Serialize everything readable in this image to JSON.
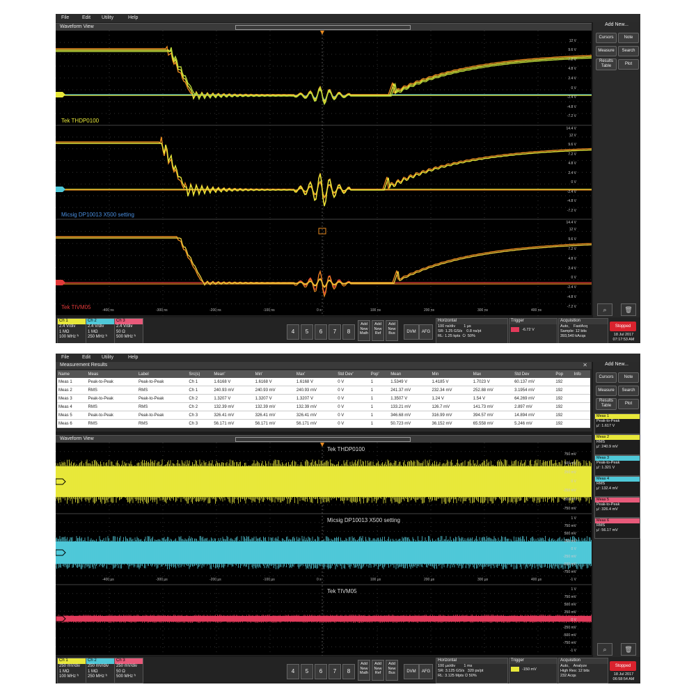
{
  "menu": [
    "File",
    "Edit",
    "Utility",
    "Help"
  ],
  "shot1": {
    "waveform_title": "Waveform View",
    "panel_labels": [
      {
        "text": "Tek THDP0100",
        "color": "#e8e83a"
      },
      {
        "text": "Micsig DP10013 X500 setting",
        "color": "#4a8fe0"
      },
      {
        "text": "Tek TIVM05",
        "color": "#e23a3a"
      }
    ],
    "vticks": [
      "12 V",
      "9.6 V",
      "7.2 V",
      "4.8 V",
      "2.4 V",
      "0 V",
      "-2.4 V",
      "-4.8 V",
      "-7.2 V"
    ],
    "vticks_top": "14.4 V",
    "time_labels": [
      "-400 ns",
      "-300 ns",
      "-200 ns",
      "-100 ns",
      "0 s",
      "100 ns",
      "200 ns",
      "300 ns",
      "400 ns"
    ],
    "channels": [
      {
        "name": "Ch 1",
        "color": "#e8e83a",
        "lines": [
          "2.4 V/div",
          "1 MΩ",
          "100 MHz ʰ"
        ]
      },
      {
        "name": "Ch 2",
        "color": "#4fc8d8",
        "lines": [
          "2.4 V/div",
          "1 MΩ",
          "250 MHz ʰ"
        ]
      },
      {
        "name": "Ch 3",
        "color": "#e85a7a",
        "lines": [
          "2.4 V/div",
          "50 Ω",
          "500 MHz ʰ"
        ]
      }
    ],
    "horizontal": {
      "title": "Horizontal",
      "lines": [
        "100 ns/div        1 µs",
        "SR: 1.25 GS/s    0.8 ns/pt",
        "RL: 1.25 kpts  ⏻  50%"
      ]
    },
    "trigger": {
      "title": "Trigger",
      "value": "-6.72 V"
    },
    "acquisition": {
      "title": "Acquisition",
      "lines": [
        "Auto,    FastAcq",
        "Sample: 12 bits",
        "393,540 kAcqs"
      ]
    },
    "status": "Stopped",
    "date": "18 Jul 2017",
    "time": "07:17:53 AM"
  },
  "shot2": {
    "results_title": "Measurement Results",
    "columns": [
      "Name",
      "Meas",
      "Label",
      "Src(s)",
      "Mean'",
      "Min'",
      "Max'",
      "Std Dev'",
      "Pop'",
      "Mean",
      "Min",
      "Max",
      "Std Dev",
      "Pop",
      "Info"
    ],
    "rows": [
      [
        "Meas 1",
        "Peak-to-Peak",
        "Peak-to-Peak",
        "Ch 1",
        "1.6168 V",
        "1.6168 V",
        "1.6168 V",
        "0 V",
        "1",
        "1.5349 V",
        "1.4185 V",
        "1.7023 V",
        "60.137 mV",
        "192",
        ""
      ],
      [
        "Meas 2",
        "RMS",
        "RMS",
        "Ch 1",
        "240.93 mV",
        "240.93 mV",
        "240.93 mV",
        "0 V",
        "1",
        "241.37 mV",
        "232.34 mV",
        "252.88 mV",
        "3.1954 mV",
        "192",
        ""
      ],
      [
        "Meas 3",
        "Peak-to-Peak",
        "Peak-to-Peak",
        "Ch 2",
        "1.3207 V",
        "1.3207 V",
        "1.3207 V",
        "0 V",
        "1",
        "1.3507 V",
        "1.24 V",
        "1.54 V",
        "64.269 mV",
        "192",
        ""
      ],
      [
        "Meas 4",
        "RMS",
        "RMS",
        "Ch 2",
        "132.39 mV",
        "132.39 mV",
        "132.39 mV",
        "0 V",
        "1",
        "133.21 mV",
        "126.7 mV",
        "141.73 mV",
        "2.897 mV",
        "192",
        ""
      ],
      [
        "Meas 5",
        "Peak-to-Peak",
        "Peak-to-Peak",
        "Ch 3",
        "326.41 mV",
        "326.41 mV",
        "326.41 mV",
        "0 V",
        "1",
        "346.68 mV",
        "316.99 mV",
        "394.57 mV",
        "14.894 mV",
        "192",
        ""
      ],
      [
        "Meas 6",
        "RMS",
        "RMS",
        "Ch 3",
        "56.171 mV",
        "56.171 mV",
        "56.171 mV",
        "0 V",
        "1",
        "50.723 mV",
        "36.152 mV",
        "65.558 mV",
        "5.246 mV",
        "192",
        ""
      ]
    ],
    "waveform_title": "Waveform View",
    "panel_labels": [
      "Tek THDP0100",
      "Micsig DP10013 X500 setting",
      "Tek TIVM05"
    ],
    "vticks_a": [
      "750 mV",
      "500 mV",
      "250 mV",
      "0 V",
      "-250 mV",
      "-500 mV",
      "-750 mV"
    ],
    "vticks_b": [
      "1 V",
      "750 mV",
      "500 mV",
      "250 mV",
      "0 V",
      "-250 mV",
      "-500 mV",
      "-750 mV",
      "-1 V"
    ],
    "vticks_c": [
      "1 V",
      "750 mV",
      "500 mV",
      "250 mV",
      "0 V",
      "-250 mV",
      "-500 mV",
      "-750 mV",
      "-1 V"
    ],
    "time_labels": [
      "-400 µs",
      "-300 µs",
      "-200 µs",
      "-100 µs",
      "0 s",
      "100 µs",
      "200 µs",
      "300 µs",
      "400 µs"
    ],
    "cards": [
      {
        "name": "Meas 1",
        "color": "#e8e83a",
        "type": "Peak-to-Peak",
        "value": "µ': 1.617 V"
      },
      {
        "name": "Meas 2",
        "color": "#e8e83a",
        "type": "RMS",
        "value": "µ': 240.9 mV"
      },
      {
        "name": "Meas 3",
        "color": "#4fc8d8",
        "type": "Peak-to-Peak",
        "value": "µ': 1.321 V"
      },
      {
        "name": "Meas 4",
        "color": "#4fc8d8",
        "type": "RMS",
        "value": "µ': 132.4 mV"
      },
      {
        "name": "Meas 5",
        "color": "#e85a7a",
        "type": "Peak-to-Peak",
        "value": "µ': 326.4 mV"
      },
      {
        "name": "Meas 6",
        "color": "#e85a7a",
        "type": "RMS",
        "value": "µ': 56.17 mV"
      }
    ],
    "channels": [
      {
        "name": "Ch 1",
        "color": "#e8e83a",
        "lines": [
          "250 mV/div",
          "1 MΩ",
          "100 MHz ʰ"
        ]
      },
      {
        "name": "Ch 2",
        "color": "#4fc8d8",
        "lines": [
          "250 mV/div",
          "1 MΩ",
          "250 MHz ʰ"
        ]
      },
      {
        "name": "Ch 3",
        "color": "#e85a7a",
        "lines": [
          "250 mV/div",
          "50 Ω",
          "500 MHz ʰ"
        ]
      }
    ],
    "horizontal": {
      "title": "Horizontal",
      "lines": [
        "100 µs/div        1 ms",
        "SR: 3.125 GS/s   320 ps/pt",
        "RL: 3.125 Mpts ⏻ 50%"
      ]
    },
    "trigger": {
      "title": "Trigger",
      "value": "-150 mV"
    },
    "acquisition": {
      "title": "Acquisition",
      "lines": [
        "Auto,    Analyze",
        "High Res: 12 bits",
        "232 Acqs"
      ]
    },
    "status": "Stopped",
    "date": "18 Jul 2017",
    "time": "06:58:54 AM"
  },
  "side": {
    "title": "Add New...",
    "buttons": [
      "Cursors",
      "Note",
      "Measure",
      "Search",
      "Results Table",
      "Plot"
    ]
  },
  "numbers": [
    "4",
    "5",
    "6",
    "7",
    "8"
  ],
  "add_buttons": [
    [
      "Add",
      "New",
      "Math"
    ],
    [
      "Add",
      "New",
      "Ref"
    ],
    [
      "Add",
      "New",
      "Bus"
    ]
  ],
  "dvm": "DVM",
  "afg": "AFG",
  "colors": {
    "ch1": "#e8e83a",
    "ch2": "#4fc8d8",
    "ch3": "#e23a5a",
    "orange": "#e88a20"
  }
}
